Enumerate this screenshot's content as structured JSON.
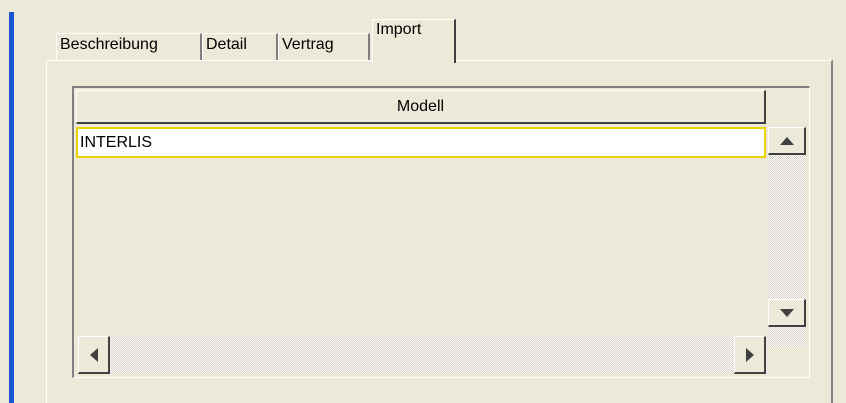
{
  "tabs": [
    {
      "label": "Beschreibung",
      "active": false
    },
    {
      "label": "Detail",
      "active": false
    },
    {
      "label": "Vertrag",
      "active": false
    },
    {
      "label": "Import",
      "active": true
    }
  ],
  "table": {
    "columns": [
      "Modell"
    ],
    "rows": [
      {
        "modell": "INTERLIS",
        "selected": true
      }
    ]
  },
  "icons": {
    "scroll_up": "triangle-up-icon",
    "scroll_down": "triangle-down-icon",
    "scroll_left": "triangle-left-icon",
    "scroll_right": "triangle-right-icon"
  },
  "colors": {
    "background": "#ece9d8",
    "accent_bar": "#1a56d6",
    "row_selection_border": "#e8d500",
    "row_background": "#ffffff"
  }
}
